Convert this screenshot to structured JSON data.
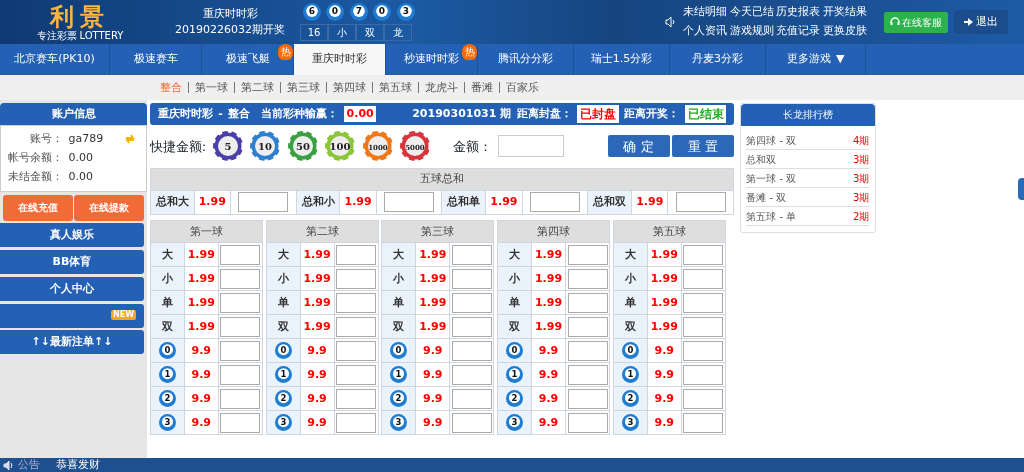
{
  "header": {
    "logo": {
      "title": "利景",
      "tagline": "专注彩票",
      "tagline_en": "LOTTERY"
    },
    "draw": {
      "game": "重庆时时彩",
      "issue": "20190226032期开奖",
      "balls": [
        "6",
        "0",
        "7",
        "0",
        "3"
      ],
      "stats": [
        "16",
        "小",
        "双",
        "龙"
      ]
    },
    "links": [
      "未结明细",
      "今天已结",
      "历史报表",
      "开奖结果",
      "个人资讯",
      "游戏规则",
      "充值记录",
      "更换皮肤"
    ],
    "service_button": "在线客服",
    "logout_button": "退出"
  },
  "nav_tabs": [
    {
      "label": "北京赛车(PK10)",
      "selected": false
    },
    {
      "label": "极速赛车",
      "selected": false
    },
    {
      "label": "极速飞艇",
      "selected": false,
      "badge": "热"
    },
    {
      "label": "重庆时时彩",
      "selected": true
    },
    {
      "label": "秒速时时彩",
      "selected": false,
      "badge": "热"
    },
    {
      "label": "腾讯分分彩",
      "selected": false
    },
    {
      "label": "瑞士1.5分彩",
      "selected": false
    },
    {
      "label": "丹麦3分彩",
      "selected": false
    },
    {
      "label": "更多游戏",
      "selected": false,
      "caret": "▼"
    }
  ],
  "sub_tabs": [
    {
      "label": "整合",
      "selected": true
    },
    {
      "label": "第一球",
      "selected": false
    },
    {
      "label": "第二球",
      "selected": false
    },
    {
      "label": "第三球",
      "selected": false
    },
    {
      "label": "第四球",
      "selected": false
    },
    {
      "label": "第五球",
      "selected": false
    },
    {
      "label": "龙虎斗",
      "selected": false
    },
    {
      "label": "番滩",
      "selected": false
    },
    {
      "label": "百家乐",
      "selected": false
    }
  ],
  "account": {
    "title": "账户信息",
    "rows": [
      {
        "label": "账号：",
        "value": "ga789"
      },
      {
        "label": "帐号余额：",
        "value": "0.00"
      },
      {
        "label": "未结金额：",
        "value": "0.00"
      }
    ],
    "buttons": [
      "在线充值",
      "在线提款"
    ],
    "menu": [
      {
        "label": "真人娱乐"
      },
      {
        "label": "BB体育"
      },
      {
        "label": "个人中心"
      },
      {
        "badge": "NEW"
      },
      {
        "label": "↑↓最新注单↑↓"
      }
    ]
  },
  "bet_header": {
    "game": "重庆时时彩",
    "separator": "-",
    "play": "整合",
    "profit_label": "当前彩种输赢：",
    "profit": "0.00",
    "issue": "20190301031 期",
    "statuses": [
      {
        "label": "距离封盘：",
        "value": "已封盘",
        "color": "#ff0000"
      },
      {
        "label": "距离开奖：",
        "value": "已结束",
        "color": "#22aa22"
      }
    ]
  },
  "quick": {
    "label": "快捷金额:",
    "chips": [
      {
        "value": "5",
        "color": "#4a3fa8"
      },
      {
        "value": "10",
        "color": "#2f7fd0"
      },
      {
        "value": "50",
        "color": "#3aa040"
      },
      {
        "value": "100",
        "color": "#8cc43a"
      },
      {
        "value": "1000",
        "color": "#f07818"
      },
      {
        "value": "5000",
        "color": "#d8343c"
      }
    ],
    "amount_label": "金额：",
    "buttons": [
      "确 定",
      "重 置"
    ]
  },
  "sum_table": {
    "title": "五球总和",
    "cells": [
      {
        "label": "总和大",
        "odds": "1.99"
      },
      {
        "label": "总和小",
        "odds": "1.99"
      },
      {
        "label": "总和单",
        "odds": "1.99"
      },
      {
        "label": "总和双",
        "odds": "1.99"
      }
    ]
  },
  "ball_tables": [
    {
      "title": "第一球",
      "rows": [
        {
          "kind": "text",
          "label": "大",
          "odds": "1.99"
        },
        {
          "kind": "text",
          "label": "小",
          "odds": "1.99"
        },
        {
          "kind": "text",
          "label": "单",
          "odds": "1.99"
        },
        {
          "kind": "text",
          "label": "双",
          "odds": "1.99"
        },
        {
          "kind": "ball",
          "label": "0",
          "odds": "9.9"
        },
        {
          "kind": "ball",
          "label": "1",
          "odds": "9.9"
        },
        {
          "kind": "ball",
          "label": "2",
          "odds": "9.9"
        },
        {
          "kind": "ball",
          "label": "3",
          "odds": "9.9"
        }
      ]
    },
    {
      "title": "第二球",
      "rows": [
        {
          "kind": "text",
          "label": "大",
          "odds": "1.99"
        },
        {
          "kind": "text",
          "label": "小",
          "odds": "1.99"
        },
        {
          "kind": "text",
          "label": "单",
          "odds": "1.99"
        },
        {
          "kind": "text",
          "label": "双",
          "odds": "1.99"
        },
        {
          "kind": "ball",
          "label": "0",
          "odds": "9.9"
        },
        {
          "kind": "ball",
          "label": "1",
          "odds": "9.9"
        },
        {
          "kind": "ball",
          "label": "2",
          "odds": "9.9"
        },
        {
          "kind": "ball",
          "label": "3",
          "odds": "9.9"
        }
      ]
    },
    {
      "title": "第三球",
      "rows": [
        {
          "kind": "text",
          "label": "大",
          "odds": "1.99"
        },
        {
          "kind": "text",
          "label": "小",
          "odds": "1.99"
        },
        {
          "kind": "text",
          "label": "单",
          "odds": "1.99"
        },
        {
          "kind": "text",
          "label": "双",
          "odds": "1.99"
        },
        {
          "kind": "ball",
          "label": "0",
          "odds": "9.9"
        },
        {
          "kind": "ball",
          "label": "1",
          "odds": "9.9"
        },
        {
          "kind": "ball",
          "label": "2",
          "odds": "9.9"
        },
        {
          "kind": "ball",
          "label": "3",
          "odds": "9.9"
        }
      ]
    },
    {
      "title": "第四球",
      "rows": [
        {
          "kind": "text",
          "label": "大",
          "odds": "1.99"
        },
        {
          "kind": "text",
          "label": "小",
          "odds": "1.99"
        },
        {
          "kind": "text",
          "label": "单",
          "odds": "1.99"
        },
        {
          "kind": "text",
          "label": "双",
          "odds": "1.99"
        },
        {
          "kind": "ball",
          "label": "0",
          "odds": "9.9"
        },
        {
          "kind": "ball",
          "label": "1",
          "odds": "9.9"
        },
        {
          "kind": "ball",
          "label": "2",
          "odds": "9.9"
        },
        {
          "kind": "ball",
          "label": "3",
          "odds": "9.9"
        }
      ]
    },
    {
      "title": "第五球",
      "rows": [
        {
          "kind": "text",
          "label": "大",
          "odds": "1.99"
        },
        {
          "kind": "text",
          "label": "小",
          "odds": "1.99"
        },
        {
          "kind": "text",
          "label": "单",
          "odds": "1.99"
        },
        {
          "kind": "text",
          "label": "双",
          "odds": "1.99"
        },
        {
          "kind": "ball",
          "label": "0",
          "odds": "9.9"
        },
        {
          "kind": "ball",
          "label": "1",
          "odds": "9.9"
        },
        {
          "kind": "ball",
          "label": "2",
          "odds": "9.9"
        },
        {
          "kind": "ball",
          "label": "3",
          "odds": "9.9"
        }
      ]
    }
  ],
  "ranking": {
    "title": "长龙排行榜",
    "items": [
      {
        "label": "第四球 - 双",
        "count": "4期"
      },
      {
        "label": "总和双",
        "count": "3期"
      },
      {
        "label": "第一球 - 双",
        "count": "3期"
      },
      {
        "label": "番滩 - 双",
        "count": "3期"
      },
      {
        "label": "第五球 - 单",
        "count": "2期"
      }
    ]
  },
  "footer": {
    "notice_label": "公告",
    "message": "恭喜发财"
  }
}
